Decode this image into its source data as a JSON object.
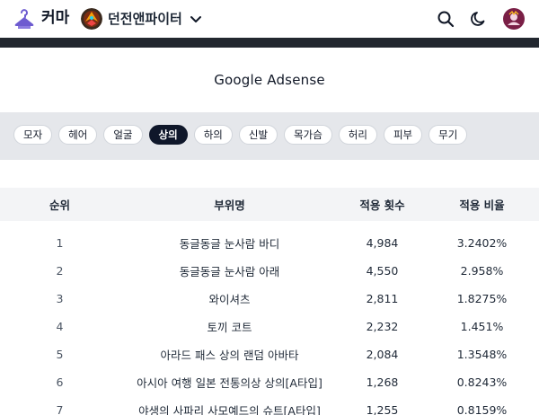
{
  "header": {
    "brand": "커마",
    "game_name": "던전앤파이터",
    "icons": {
      "logo": "hanger-icon",
      "game": "game-emblem-icon",
      "dropdown": "chevron-down-icon",
      "search": "search-icon",
      "theme": "moon-icon",
      "profile": "avatar"
    }
  },
  "ad": {
    "title": "Google Adsense"
  },
  "categories": {
    "items": [
      "모자",
      "헤어",
      "얼굴",
      "상의",
      "하의",
      "신발",
      "목가슴",
      "허리",
      "피부",
      "무기"
    ],
    "selected": "상의"
  },
  "table": {
    "headers": [
      "순위",
      "부위명",
      "적용 횟수",
      "적용 비율"
    ],
    "rows": [
      {
        "rank": "1",
        "name": "동글동글 눈사람 바디",
        "count": "4,984",
        "ratio": "3.2402%"
      },
      {
        "rank": "2",
        "name": "동글동글 눈사람 아래",
        "count": "4,550",
        "ratio": "2.958%"
      },
      {
        "rank": "3",
        "name": "와이셔츠",
        "count": "2,811",
        "ratio": "1.8275%"
      },
      {
        "rank": "4",
        "name": "토끼 코트",
        "count": "2,232",
        "ratio": "1.451%"
      },
      {
        "rank": "5",
        "name": "아라드 패스 상의 랜덤 아바타",
        "count": "2,084",
        "ratio": "1.3548%"
      },
      {
        "rank": "6",
        "name": "아시아 여행 일본 전통의상 상의[A타입]",
        "count": "1,268",
        "ratio": "0.8243%"
      },
      {
        "rank": "7",
        "name": "야생의 사파리 사모예드의 슈트[A타입]",
        "count": "1,255",
        "ratio": "0.8159%"
      }
    ]
  },
  "colors": {
    "accent": "#6d5bd0",
    "dark_bar": "#22272f",
    "chip_active": "#0f172a",
    "chip_bar": "#e5e7eb",
    "table_head": "#f3f4f6"
  }
}
